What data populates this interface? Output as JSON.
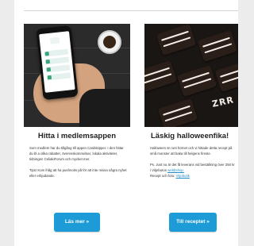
{
  "cards": [
    {
      "title": "Hitta i medlemsappen",
      "body": [
        "Som medlem har du tillgång till appen Cardskipper. I den hittar du bl a olika rabatter, överenskommelser, lokala aktiviteter, tidningen CeliakiForum och mycket mer.",
        "Tips! Kom ihåg att ha pushnotis på för att inte missa några nyhet eller erbjudande."
      ],
      "button_label": "Läs mer »",
      "image": "phone-app-photo"
    },
    {
      "title": "Läskig halloweenfika!",
      "body": [
        "Halloween är runt hörnet och vi hittade detta recept på små monster att baka till helgens fireste."
      ],
      "body_ps_prefix": "Ps. Just nu är det få leverans vid beställning över 250 kr i Vitjebutos",
      "body_ps_link": "webbshop.",
      "recipe_prefix": "Recept och foto:",
      "recipe_link": "Vitjebutik",
      "button_label": "Till receptet »",
      "image": "halloween-brownies-photo",
      "image_lettering": "ZRR"
    }
  ],
  "colors": {
    "button": "#1d9bd7",
    "link": "#1d8bc4",
    "background": "#ececec"
  }
}
